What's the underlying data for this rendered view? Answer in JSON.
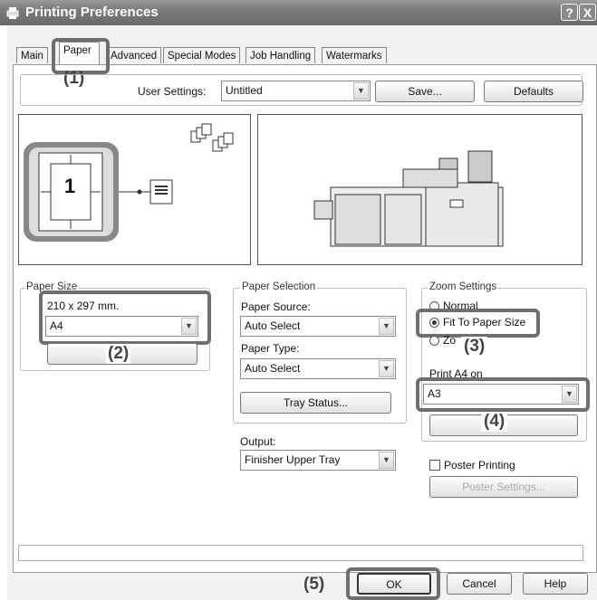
{
  "window": {
    "title": "Printing Preferences",
    "help_btn": "?",
    "close_btn": "X"
  },
  "tabs": [
    "Main",
    "Paper",
    "Advanced",
    "Special Modes",
    "Job Handling",
    "Watermarks"
  ],
  "active_tab": "Paper",
  "user_settings": {
    "label": "User Settings:",
    "value": "Untitled",
    "save": "Save...",
    "defaults": "Defaults"
  },
  "preview": {
    "page_number": "1"
  },
  "paper_size": {
    "title": "Paper Size",
    "dimensions": "210 x 297 mm.",
    "value": "A4"
  },
  "paper_selection": {
    "title": "Paper Selection",
    "source_label": "Paper Source:",
    "source_value": "Auto Select",
    "type_label": "Paper Type:",
    "type_value": "Auto Select",
    "tray_status": "Tray Status..."
  },
  "output": {
    "label": "Output:",
    "value": "Finisher Upper Tray"
  },
  "zoom": {
    "title": "Zoom Settings",
    "normal": "Normal",
    "fit": "Fit To Paper Size",
    "zoom_partial": "Zo",
    "print_on_label": "Print A4 on",
    "print_on_value": "A3",
    "settings_partial": "S"
  },
  "poster": {
    "label": "Poster Printing",
    "settings": "Poster Settings..."
  },
  "buttons": {
    "ok": "OK",
    "cancel": "Cancel",
    "help": "Help"
  },
  "callouts": [
    "(1)",
    "(2)",
    "(3)",
    "(4)",
    "(5)"
  ]
}
